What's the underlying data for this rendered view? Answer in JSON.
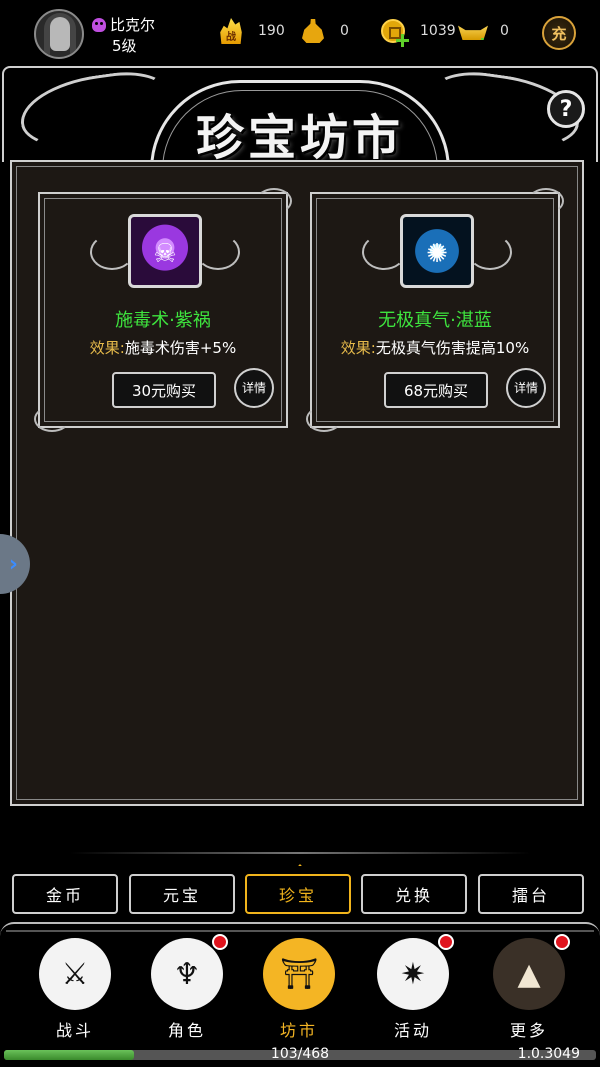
{
  "player": {
    "name": "比克尔",
    "level": "5级"
  },
  "resources": {
    "battle": {
      "icon": "battle-power-icon",
      "icon_text": "战",
      "value": "190"
    },
    "gourd": {
      "icon": "gourd-icon",
      "value": "0"
    },
    "coin": {
      "icon": "coin-add-icon",
      "value": "1039"
    },
    "ingot": {
      "icon": "ingot-add-icon",
      "value": "0"
    }
  },
  "recharge_label": "充",
  "header": {
    "title": "珍宝坊市",
    "help_label": "?"
  },
  "items": [
    {
      "name": "施毒术·紫祸",
      "icon": "poison-skull-icon",
      "effect_label": "效果:",
      "effect_text": "施毒术伤害+5%",
      "price_label": "30元购买",
      "detail_label": "详情",
      "icon_color": "#9a38e0"
    },
    {
      "name": "无极真气·湛蓝",
      "icon": "blue-vortex-icon",
      "effect_label": "效果:",
      "effect_text": "无极真气伤害提高10%",
      "price_label": "68元购买",
      "detail_label": "详情",
      "icon_color": "#1a6fb8"
    }
  ],
  "side_toggle_icon": "chevron-right-icon",
  "tabs": [
    {
      "label": "金币",
      "active": false
    },
    {
      "label": "元宝",
      "active": false
    },
    {
      "label": "珍宝",
      "active": true
    },
    {
      "label": "兑换",
      "active": false
    },
    {
      "label": "擂台",
      "active": false
    }
  ],
  "nav": [
    {
      "label": "战斗",
      "icon": "crossed-swords-icon",
      "badge": false,
      "active": false
    },
    {
      "label": "角色",
      "icon": "demon-mask-icon",
      "badge": true,
      "active": false
    },
    {
      "label": "坊市",
      "icon": "market-gate-icon",
      "badge": false,
      "active": true
    },
    {
      "label": "活动",
      "icon": "treasure-chest-icon",
      "badge": true,
      "active": false
    },
    {
      "label": "更多",
      "icon": "more-emblem-icon",
      "badge": true,
      "active": false
    }
  ],
  "progress": {
    "text": "103/468",
    "current": 103,
    "total": 468
  },
  "version": "1.0.3049",
  "colors": {
    "accent": "#f1b41c",
    "item_name": "#3ee43e",
    "effect_label": "#e5b94a",
    "badge": "#e0141e"
  }
}
